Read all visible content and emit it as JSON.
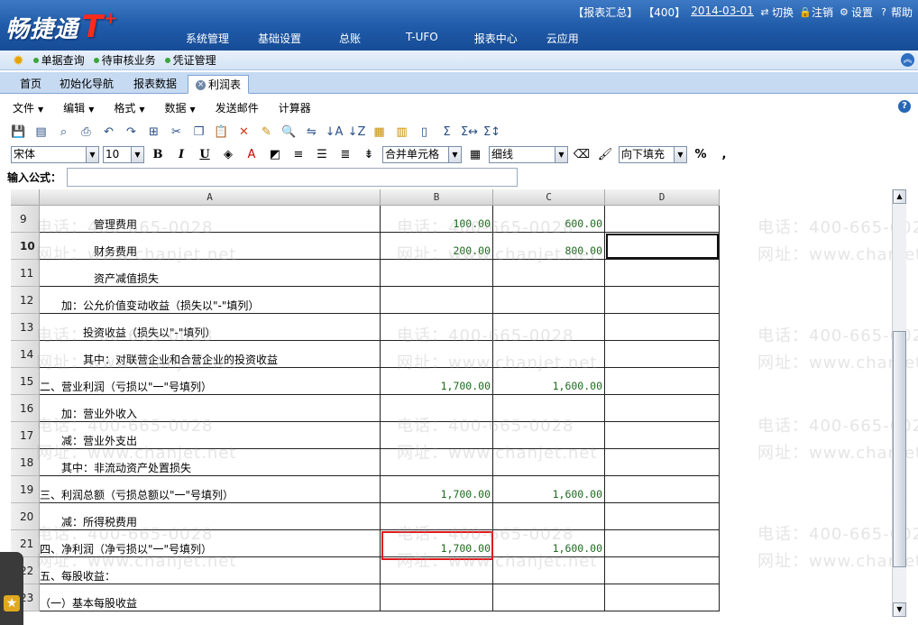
{
  "header": {
    "logo_text": "畅捷通",
    "logo_brand": "T",
    "logo_plus": "+",
    "topbar": {
      "report_summary": "【报表汇总】",
      "account": "【400】",
      "date": "2014-03-01",
      "switch": "切换",
      "logout": "注销",
      "settings": "设置",
      "help": "帮助"
    },
    "nav": [
      "系统管理",
      "基础设置",
      "总账",
      "T-UFO",
      "报表中心",
      "云应用"
    ]
  },
  "quickbar": {
    "items": [
      "单据查询",
      "待审核业务",
      "凭证管理"
    ]
  },
  "tabs": [
    {
      "label": "首页"
    },
    {
      "label": "初始化导航"
    },
    {
      "label": "报表数据"
    },
    {
      "label": "利润表"
    }
  ],
  "menu": [
    {
      "label": "文件",
      "has_arrow": true
    },
    {
      "label": "编辑",
      "has_arrow": true
    },
    {
      "label": "格式",
      "has_arrow": true
    },
    {
      "label": "数据",
      "has_arrow": true
    },
    {
      "label": "发送邮件",
      "has_arrow": false
    },
    {
      "label": "计算器",
      "has_arrow": false
    }
  ],
  "formatbar": {
    "font": "宋体",
    "size": "10",
    "merge": "合并单元格",
    "border": "细线",
    "fill": "向下填充",
    "percent": "%",
    "comma": ","
  },
  "formula": {
    "label": "输入公式：",
    "value": ""
  },
  "sheet": {
    "columns": [
      "A",
      "B",
      "C",
      "D"
    ],
    "rows": [
      {
        "num": "9",
        "a": "　　　　　管理费用",
        "b": "100.00",
        "c": "600.00",
        "d": ""
      },
      {
        "num": "10",
        "a": "　　　　　财务费用",
        "b": "200.00",
        "c": "800.00",
        "d": ""
      },
      {
        "num": "11",
        "a": "　　　　　资产减值损失",
        "b": "",
        "c": "",
        "d": ""
      },
      {
        "num": "12",
        "a": "　　加：公允价值变动收益（损失以\"-\"填列）",
        "b": "",
        "c": "",
        "d": ""
      },
      {
        "num": "13",
        "a": "　　　　投资收益（损失以\"-\"填列）",
        "b": "",
        "c": "",
        "d": ""
      },
      {
        "num": "14",
        "a": "　　　　其中：对联营企业和合营企业的投资收益",
        "b": "",
        "c": "",
        "d": ""
      },
      {
        "num": "15",
        "a": "二、营业利润（亏损以\"一\"号填列）",
        "b": "1,700.00",
        "c": "1,600.00",
        "d": ""
      },
      {
        "num": "16",
        "a": "　　加：营业外收入",
        "b": "",
        "c": "",
        "d": ""
      },
      {
        "num": "17",
        "a": "　　减：营业外支出",
        "b": "",
        "c": "",
        "d": ""
      },
      {
        "num": "18",
        "a": "　　其中：非流动资产处置损失",
        "b": "",
        "c": "",
        "d": ""
      },
      {
        "num": "19",
        "a": "三、利润总额（亏损总额以\"一\"号填列）",
        "b": "1,700.00",
        "c": "1,600.00",
        "d": ""
      },
      {
        "num": "20",
        "a": "　　减：所得税费用",
        "b": "",
        "c": "",
        "d": ""
      },
      {
        "num": "21",
        "a": "四、净利润（净亏损以\"一\"号填列）",
        "b": "1,700.00",
        "c": "1,600.00",
        "d": ""
      },
      {
        "num": "22",
        "a": "五、每股收益：",
        "b": "",
        "c": "",
        "d": ""
      },
      {
        "num": "23",
        "a": "（一）基本每股收益",
        "b": "",
        "c": "",
        "d": ""
      }
    ]
  },
  "watermark": {
    "phone": "电话：400-665-0028",
    "web": "网址：www.chanjet.net"
  }
}
